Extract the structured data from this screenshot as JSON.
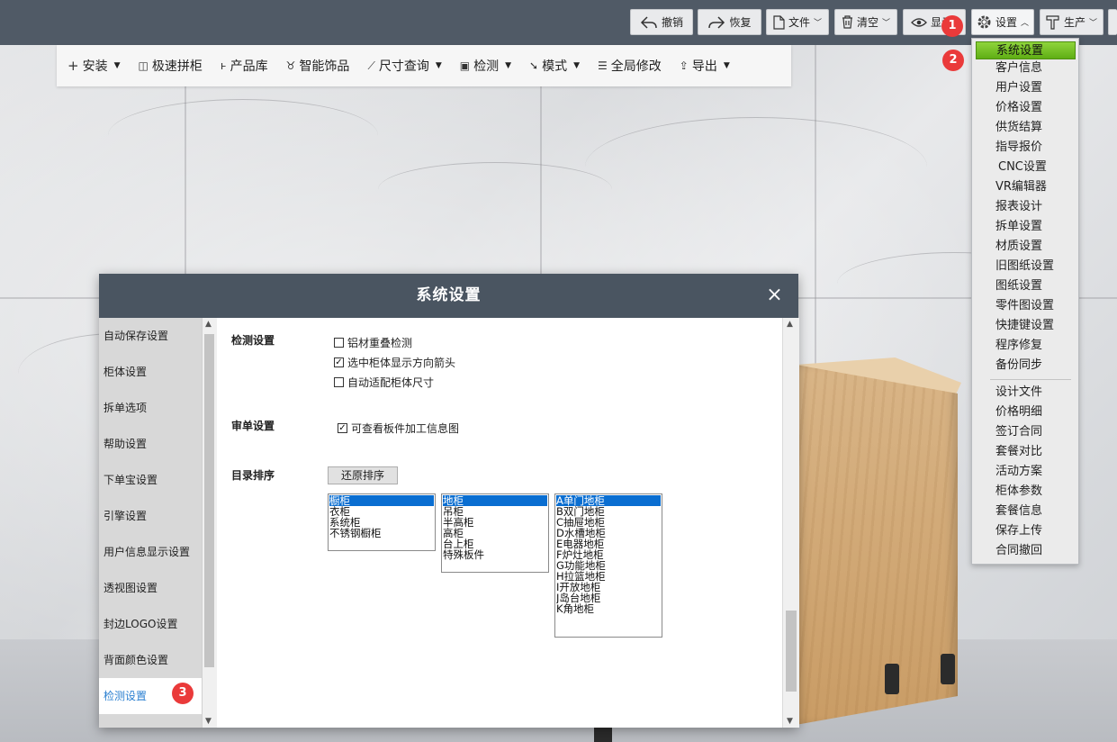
{
  "topbar": {
    "undo": "撤销",
    "redo": "恢复",
    "file": "文件",
    "clear": "清空",
    "display": "显示",
    "settings": "设置",
    "production": "生产"
  },
  "toolbar": {
    "install": "安装",
    "fast_cabinet": "极速拼柜",
    "product_library": "产品库",
    "smart_decor": "智能饰品",
    "size_query": "尺寸查询",
    "detect": "检测",
    "mode": "模式",
    "global_modify": "全局修改",
    "export": "导出"
  },
  "menu": {
    "items": [
      "系统设置",
      "客户信息",
      "用户设置",
      "价格设置",
      "供货结算",
      "指导报价",
      "CNC设置",
      "VR编辑器",
      "报表设计",
      "拆单设置",
      "材质设置",
      "旧图纸设置",
      "图纸设置",
      "零件图设置",
      "快捷键设置",
      "程序修复",
      "备份同步"
    ],
    "items2": [
      "设计文件",
      "价格明细",
      "签订合同",
      "套餐对比",
      "活动方案",
      "柜体参数",
      "套餐信息",
      "保存上传",
      "合同撤回"
    ]
  },
  "badges": [
    "1",
    "2",
    "3"
  ],
  "dialog": {
    "title": "系统设置",
    "close": "×",
    "nav": [
      "自动保存设置",
      "柜体设置",
      "拆单选项",
      "帮助设置",
      "下单宝设置",
      "引擎设置",
      "用户信息显示设置",
      "透视图设置",
      "封边LOGO设置",
      "背面颜色设置",
      "检测设置"
    ],
    "detect_label": "检测设置",
    "detect_options": [
      {
        "label": "铝材重叠检测",
        "checked": false
      },
      {
        "label": "选中柜体显示方向箭头",
        "checked": true
      },
      {
        "label": "自动适配柜体尺寸",
        "checked": false
      }
    ],
    "review_label": "审单设置",
    "review_option": {
      "label": "可查看板件加工信息图",
      "checked": true
    },
    "catalog_label": "目录排序",
    "reset_button": "还原排序",
    "list1": [
      "橱柜",
      "衣柜",
      "系统柜",
      "不锈钢橱柜"
    ],
    "list2": [
      "地柜",
      "吊柜",
      "半高柜",
      "高柜",
      "台上柜",
      "特殊板件"
    ],
    "list3": [
      "A单门地柜",
      "B双门地柜",
      "C抽屉地柜",
      "D水槽地柜",
      "E电器地柜",
      "F炉灶地柜",
      "G功能地柜",
      "H拉篮地柜",
      "I开放地柜",
      "J岛台地柜",
      "K角地柜"
    ]
  }
}
